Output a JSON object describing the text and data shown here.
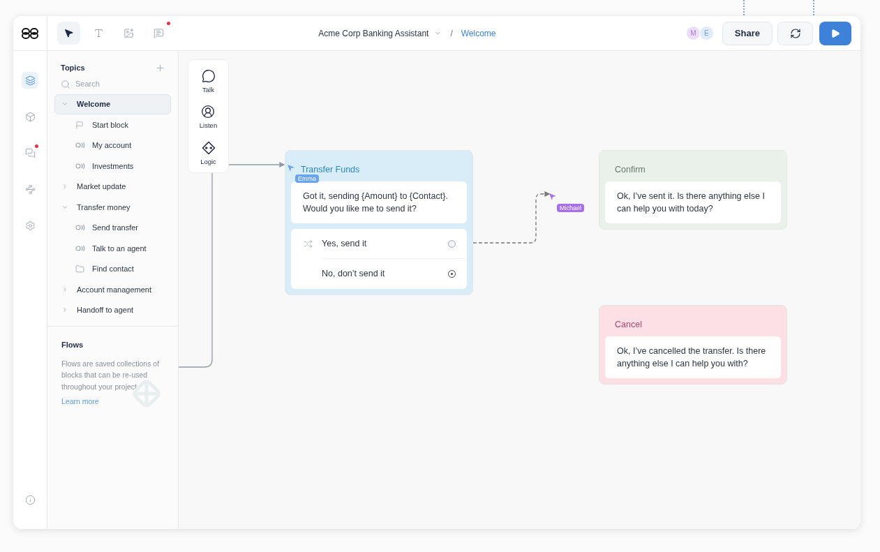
{
  "header": {
    "tools": [
      {
        "kind": "pointer",
        "selected": true,
        "badge": false
      },
      {
        "kind": "text",
        "selected": false,
        "badge": false
      },
      {
        "kind": "image",
        "selected": false,
        "badge": false
      },
      {
        "kind": "comment",
        "selected": false,
        "badge": true
      }
    ],
    "project": "Acme Corp Banking Assistant",
    "separator": "/",
    "current": "Welcome",
    "collaborators": [
      {
        "initial": "M",
        "color": "#ecdff9"
      },
      {
        "initial": "E",
        "color": "#e1ecfb"
      }
    ],
    "share": "Share"
  },
  "rail": [
    {
      "kind": "layers",
      "selected": true,
      "badge": false
    },
    {
      "kind": "box",
      "selected": false,
      "badge": false
    },
    {
      "kind": "comments",
      "selected": false,
      "badge": true
    },
    {
      "kind": "network",
      "selected": false,
      "badge": false
    },
    {
      "kind": "settings",
      "selected": false,
      "badge": false
    },
    {
      "kind": "info",
      "selected": false,
      "badge": false
    }
  ],
  "topics": {
    "title": "Topics",
    "search_placeholder": "Search",
    "items": [
      {
        "label": "Welcome",
        "selected": true,
        "expanded": true,
        "children": [
          {
            "label": "Start block",
            "kind": "start",
            "selected": false
          },
          {
            "label": "My account",
            "kind": "intent",
            "selected": false
          },
          {
            "label": "Investments",
            "kind": "intent",
            "selected": false
          }
        ]
      },
      {
        "label": "Market update",
        "selected": false,
        "expanded": false
      },
      {
        "label": "Transfer money",
        "selected": false,
        "expanded": true,
        "children": [
          {
            "label": "Send transfer",
            "kind": "intent",
            "selected": false
          },
          {
            "label": "Talk to an agent",
            "kind": "intent",
            "selected": false
          },
          {
            "label": "Find contact",
            "kind": "folder",
            "selected": false
          }
        ]
      },
      {
        "label": "Account management",
        "selected": false,
        "expanded": false
      },
      {
        "label": "Handoff to agent",
        "selected": false,
        "expanded": false
      }
    ]
  },
  "flows": {
    "title": "Flows",
    "description": "Flows are saved collections of blocks that can be re-used throughout your project.",
    "link": "Learn more"
  },
  "canvas": {
    "palette": [
      {
        "label": "Talk",
        "kind": "talk"
      },
      {
        "label": "Listen",
        "kind": "listen"
      },
      {
        "label": "Logic",
        "kind": "logic"
      }
    ],
    "nodes": [
      {
        "title": "Transfer Funds",
        "color": "#d8edf8",
        "message": "Got it, sending {Amount} to {Contact}. Would you like me to send it?",
        "choices": [
          {
            "label": "Yes, send it",
            "kind": "random",
            "selected": false
          },
          {
            "label": "No, don’t send it",
            "kind": "plain",
            "selected": true
          }
        ]
      },
      {
        "title": "Confirm",
        "color": "#eaf1ea",
        "message": "Ok, I’ve sent it. Is there anything else I can help you with today?"
      },
      {
        "title": "Cancel",
        "color": "#fde0e6",
        "message": "Ok, I’ve cancelled the transfer. Is there anything else I can help you with?"
      }
    ],
    "cursors": [
      {
        "name": "Emma",
        "color": "#6aa4ee"
      },
      {
        "name": "Michael",
        "color": "#a66ee8"
      }
    ]
  }
}
